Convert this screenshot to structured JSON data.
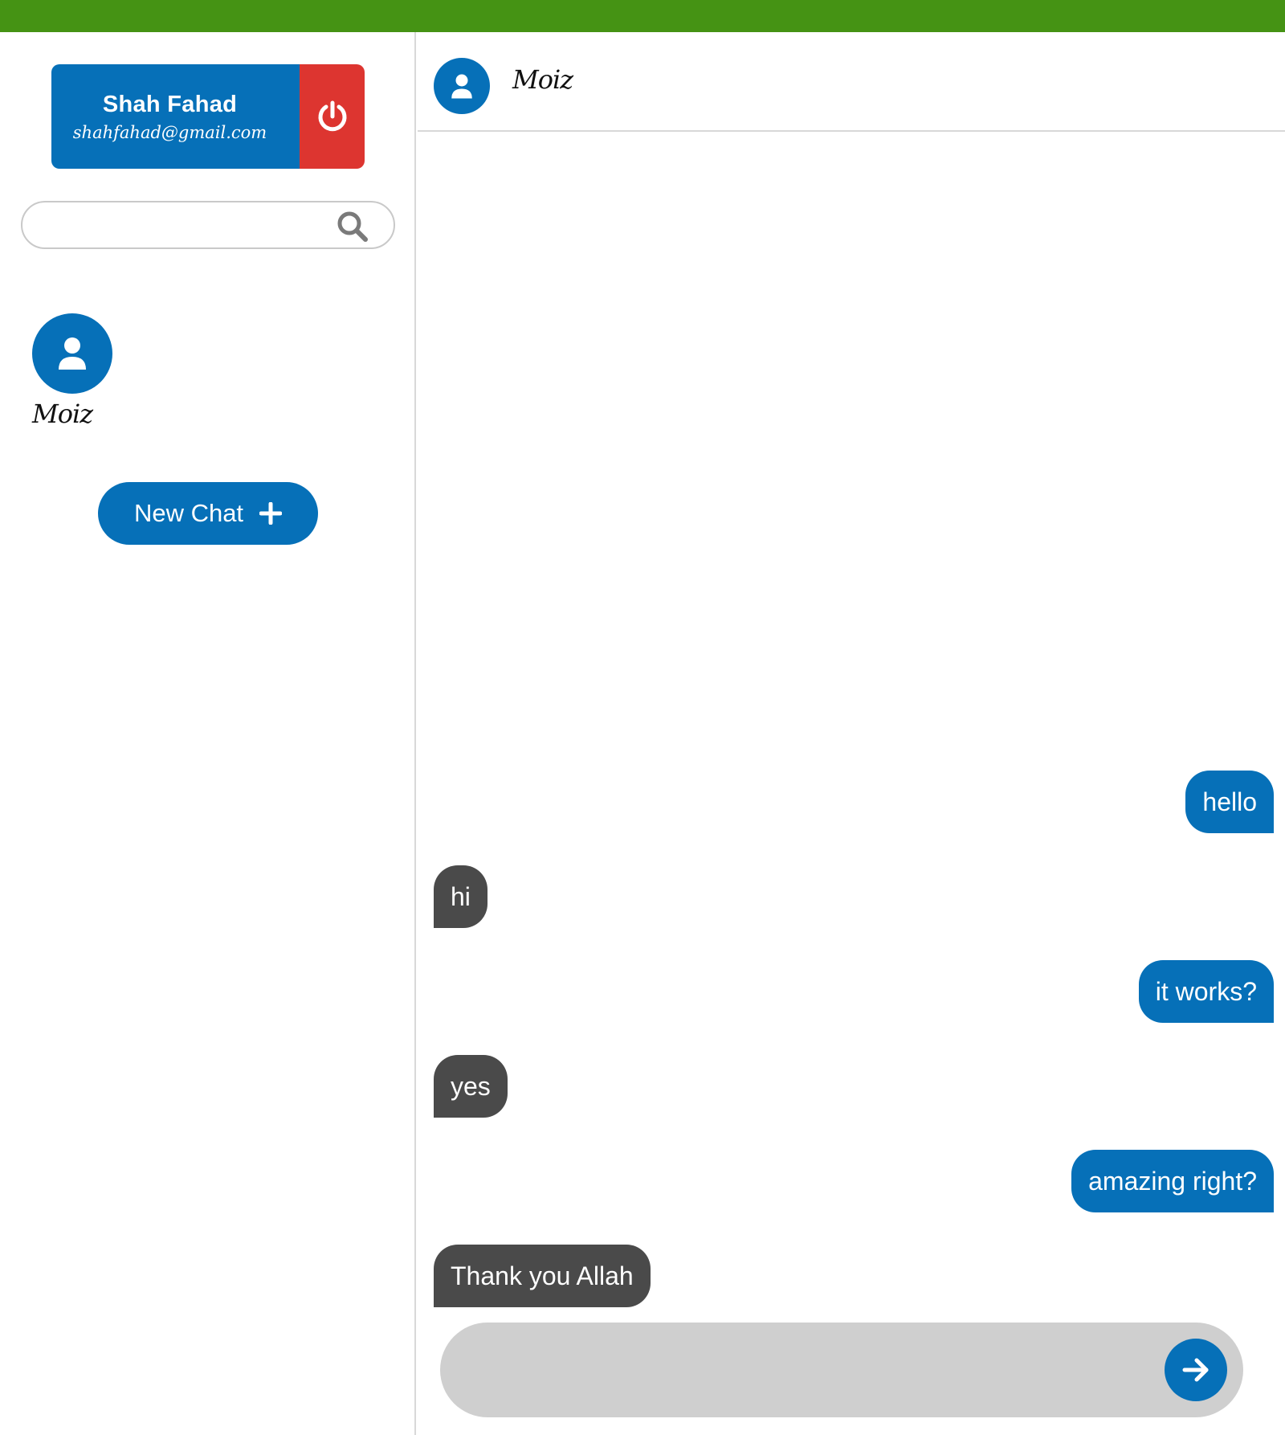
{
  "user": {
    "name": "Shah Fahad",
    "email": "shahfahad@gmail.com"
  },
  "search": {
    "value": "",
    "placeholder": ""
  },
  "contacts": [
    {
      "name": "Moiz"
    }
  ],
  "new_chat": {
    "label": "New Chat"
  },
  "chat": {
    "contact_name": "Moiz",
    "messages": [
      {
        "text": "hello",
        "direction": "sent"
      },
      {
        "text": "hi",
        "direction": "received"
      },
      {
        "text": "it works?",
        "direction": "sent"
      },
      {
        "text": "yes",
        "direction": "received"
      },
      {
        "text": "amazing right?",
        "direction": "sent"
      },
      {
        "text": "Thank you Allah",
        "direction": "received"
      }
    ]
  },
  "composer": {
    "value": "",
    "placeholder": ""
  },
  "icons": {
    "logout": "power-icon",
    "search": "search-icon",
    "avatar": "user-icon",
    "new_chat": "plus-icon",
    "send": "arrow-right-icon"
  },
  "colors": {
    "top_bar": "#459314",
    "primary": "#0670b8",
    "logout": "#dd3530",
    "received_bubble": "#4a4a4a",
    "composer_bg": "#cfcfcf"
  }
}
